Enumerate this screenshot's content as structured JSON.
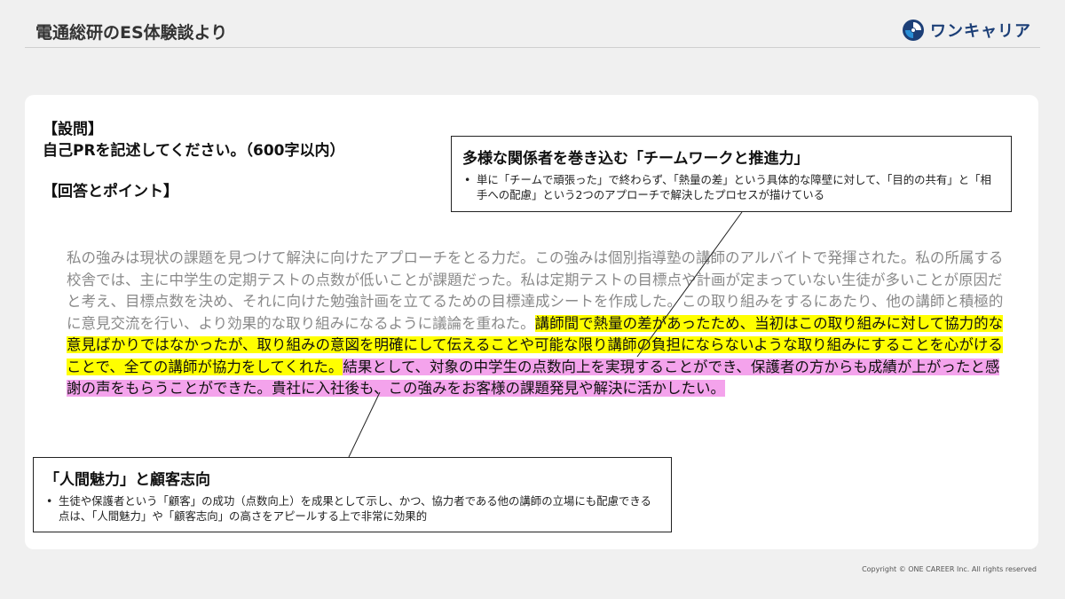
{
  "header": {
    "title": "電通総研のES体験談より",
    "logo_text": "ワンキャリア",
    "logo_icon": "onecareer-swirl-icon",
    "brand_color": "#1c3f77",
    "accent_color": "#2a8fd6"
  },
  "question": {
    "label": "【設問】",
    "text": "自己PRを記述してください。（600字以内）"
  },
  "answer_label": "【回答とポイント】",
  "answer": {
    "plain": "私の強みは現状の課題を見つけて解決に向けたアプローチをとる力だ。この強みは個別指導塾の講師のアルバイトで発揮された。私の所属する校舎では、主に中学生の定期テストの点数が低いことが課題だった。私は定期テストの目標点や計画が定まっていない生徒が多いことが原因だと考え、目標点数を決め、それに向けた勉強計画を立てるための目標達成シートを作成した。この取り組みをするにあたり、他の講師と積極的に意見交流を行い、より効果的な取り組みになるように議論を重ねた。",
    "yellow": "講師間で熱量の差があったため、当初はこの取り組みに対して協力的な意見ばかりではなかったが、取り組みの意図を明確にして伝えることや可能な限り講師の負担にならないような取り組みにすることを心がけることで、全ての講師が協力をしてくれた。",
    "pink": "結果として、対象の中学生の点数向上を実現することができ、保護者の方からも成績が上がったと感謝の声をもらうことができた。貴社に入社後も、この強みをお客様の課題発見や解決に活かしたい。",
    "highlight_yellow": "#ffff00",
    "highlight_pink": "#f4a3ec"
  },
  "callouts": {
    "top": {
      "title": "多様な関係者を巻き込む「チームワークと推進力」",
      "bullet": "•",
      "body": "単に「チームで頑張った」で終わらず、「熱量の差」という具体的な障壁に対して、「目的の共有」と「相手への配慮」という2つのアプローチで解決したプロセスが描けている"
    },
    "bottom": {
      "title": "「人間魅力」と顧客志向",
      "bullet": "•",
      "body": "生徒や保護者という「顧客」の成功（点数向上）を成果として示し、かつ、協力者である他の講師の立場にも配慮できる点は、「人間魅力」や「顧客志向」の高さをアピールする上で非常に効果的"
    }
  },
  "footer": {
    "copyright": "Copyright © ONE CAREER Inc. All rights reserved"
  }
}
